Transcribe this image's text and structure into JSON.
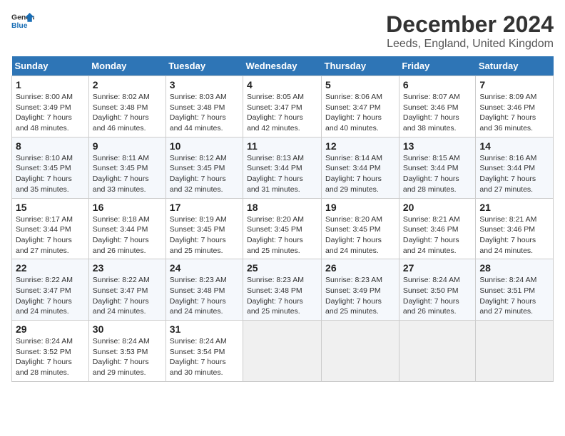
{
  "header": {
    "logo_line1": "General",
    "logo_line2": "Blue",
    "title": "December 2024",
    "subtitle": "Leeds, England, United Kingdom"
  },
  "days_of_week": [
    "Sunday",
    "Monday",
    "Tuesday",
    "Wednesday",
    "Thursday",
    "Friday",
    "Saturday"
  ],
  "weeks": [
    [
      {
        "day": "1",
        "sunrise": "Sunrise: 8:00 AM",
        "sunset": "Sunset: 3:49 PM",
        "daylight": "Daylight: 7 hours and 48 minutes."
      },
      {
        "day": "2",
        "sunrise": "Sunrise: 8:02 AM",
        "sunset": "Sunset: 3:48 PM",
        "daylight": "Daylight: 7 hours and 46 minutes."
      },
      {
        "day": "3",
        "sunrise": "Sunrise: 8:03 AM",
        "sunset": "Sunset: 3:48 PM",
        "daylight": "Daylight: 7 hours and 44 minutes."
      },
      {
        "day": "4",
        "sunrise": "Sunrise: 8:05 AM",
        "sunset": "Sunset: 3:47 PM",
        "daylight": "Daylight: 7 hours and 42 minutes."
      },
      {
        "day": "5",
        "sunrise": "Sunrise: 8:06 AM",
        "sunset": "Sunset: 3:47 PM",
        "daylight": "Daylight: 7 hours and 40 minutes."
      },
      {
        "day": "6",
        "sunrise": "Sunrise: 8:07 AM",
        "sunset": "Sunset: 3:46 PM",
        "daylight": "Daylight: 7 hours and 38 minutes."
      },
      {
        "day": "7",
        "sunrise": "Sunrise: 8:09 AM",
        "sunset": "Sunset: 3:46 PM",
        "daylight": "Daylight: 7 hours and 36 minutes."
      }
    ],
    [
      {
        "day": "8",
        "sunrise": "Sunrise: 8:10 AM",
        "sunset": "Sunset: 3:45 PM",
        "daylight": "Daylight: 7 hours and 35 minutes."
      },
      {
        "day": "9",
        "sunrise": "Sunrise: 8:11 AM",
        "sunset": "Sunset: 3:45 PM",
        "daylight": "Daylight: 7 hours and 33 minutes."
      },
      {
        "day": "10",
        "sunrise": "Sunrise: 8:12 AM",
        "sunset": "Sunset: 3:45 PM",
        "daylight": "Daylight: 7 hours and 32 minutes."
      },
      {
        "day": "11",
        "sunrise": "Sunrise: 8:13 AM",
        "sunset": "Sunset: 3:44 PM",
        "daylight": "Daylight: 7 hours and 31 minutes."
      },
      {
        "day": "12",
        "sunrise": "Sunrise: 8:14 AM",
        "sunset": "Sunset: 3:44 PM",
        "daylight": "Daylight: 7 hours and 29 minutes."
      },
      {
        "day": "13",
        "sunrise": "Sunrise: 8:15 AM",
        "sunset": "Sunset: 3:44 PM",
        "daylight": "Daylight: 7 hours and 28 minutes."
      },
      {
        "day": "14",
        "sunrise": "Sunrise: 8:16 AM",
        "sunset": "Sunset: 3:44 PM",
        "daylight": "Daylight: 7 hours and 27 minutes."
      }
    ],
    [
      {
        "day": "15",
        "sunrise": "Sunrise: 8:17 AM",
        "sunset": "Sunset: 3:44 PM",
        "daylight": "Daylight: 7 hours and 27 minutes."
      },
      {
        "day": "16",
        "sunrise": "Sunrise: 8:18 AM",
        "sunset": "Sunset: 3:44 PM",
        "daylight": "Daylight: 7 hours and 26 minutes."
      },
      {
        "day": "17",
        "sunrise": "Sunrise: 8:19 AM",
        "sunset": "Sunset: 3:45 PM",
        "daylight": "Daylight: 7 hours and 25 minutes."
      },
      {
        "day": "18",
        "sunrise": "Sunrise: 8:20 AM",
        "sunset": "Sunset: 3:45 PM",
        "daylight": "Daylight: 7 hours and 25 minutes."
      },
      {
        "day": "19",
        "sunrise": "Sunrise: 8:20 AM",
        "sunset": "Sunset: 3:45 PM",
        "daylight": "Daylight: 7 hours and 24 minutes."
      },
      {
        "day": "20",
        "sunrise": "Sunrise: 8:21 AM",
        "sunset": "Sunset: 3:46 PM",
        "daylight": "Daylight: 7 hours and 24 minutes."
      },
      {
        "day": "21",
        "sunrise": "Sunrise: 8:21 AM",
        "sunset": "Sunset: 3:46 PM",
        "daylight": "Daylight: 7 hours and 24 minutes."
      }
    ],
    [
      {
        "day": "22",
        "sunrise": "Sunrise: 8:22 AM",
        "sunset": "Sunset: 3:47 PM",
        "daylight": "Daylight: 7 hours and 24 minutes."
      },
      {
        "day": "23",
        "sunrise": "Sunrise: 8:22 AM",
        "sunset": "Sunset: 3:47 PM",
        "daylight": "Daylight: 7 hours and 24 minutes."
      },
      {
        "day": "24",
        "sunrise": "Sunrise: 8:23 AM",
        "sunset": "Sunset: 3:48 PM",
        "daylight": "Daylight: 7 hours and 24 minutes."
      },
      {
        "day": "25",
        "sunrise": "Sunrise: 8:23 AM",
        "sunset": "Sunset: 3:48 PM",
        "daylight": "Daylight: 7 hours and 25 minutes."
      },
      {
        "day": "26",
        "sunrise": "Sunrise: 8:23 AM",
        "sunset": "Sunset: 3:49 PM",
        "daylight": "Daylight: 7 hours and 25 minutes."
      },
      {
        "day": "27",
        "sunrise": "Sunrise: 8:24 AM",
        "sunset": "Sunset: 3:50 PM",
        "daylight": "Daylight: 7 hours and 26 minutes."
      },
      {
        "day": "28",
        "sunrise": "Sunrise: 8:24 AM",
        "sunset": "Sunset: 3:51 PM",
        "daylight": "Daylight: 7 hours and 27 minutes."
      }
    ],
    [
      {
        "day": "29",
        "sunrise": "Sunrise: 8:24 AM",
        "sunset": "Sunset: 3:52 PM",
        "daylight": "Daylight: 7 hours and 28 minutes."
      },
      {
        "day": "30",
        "sunrise": "Sunrise: 8:24 AM",
        "sunset": "Sunset: 3:53 PM",
        "daylight": "Daylight: 7 hours and 29 minutes."
      },
      {
        "day": "31",
        "sunrise": "Sunrise: 8:24 AM",
        "sunset": "Sunset: 3:54 PM",
        "daylight": "Daylight: 7 hours and 30 minutes."
      },
      null,
      null,
      null,
      null
    ]
  ]
}
